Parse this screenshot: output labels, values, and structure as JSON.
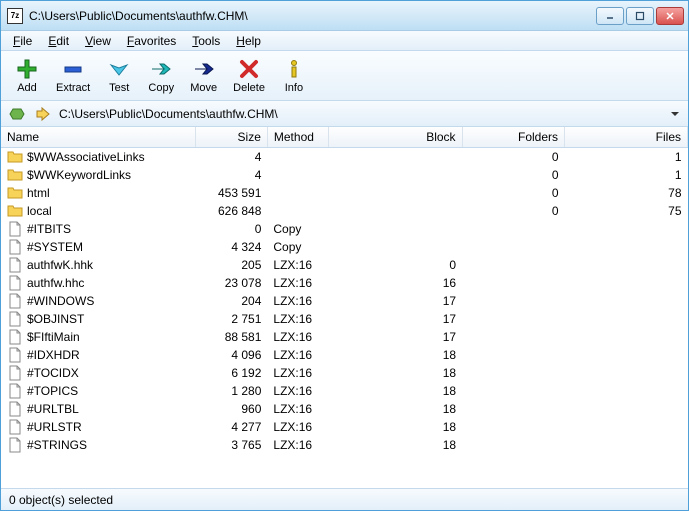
{
  "window": {
    "title": "C:\\Users\\Public\\Documents\\authfw.CHM\\"
  },
  "menus": [
    "File",
    "Edit",
    "View",
    "Favorites",
    "Tools",
    "Help"
  ],
  "toolbar": [
    {
      "id": "add",
      "label": "Add"
    },
    {
      "id": "extract",
      "label": "Extract"
    },
    {
      "id": "test",
      "label": "Test"
    },
    {
      "id": "copy",
      "label": "Copy"
    },
    {
      "id": "move",
      "label": "Move"
    },
    {
      "id": "delete",
      "label": "Delete"
    },
    {
      "id": "info",
      "label": "Info"
    }
  ],
  "address": {
    "path": "C:\\Users\\Public\\Documents\\authfw.CHM\\"
  },
  "columns": [
    "Name",
    "Size",
    "Method",
    "Block",
    "Folders",
    "Files"
  ],
  "rows": [
    {
      "type": "folder",
      "name": "$WWAssociativeLinks",
      "size": "4",
      "method": "",
      "block": "",
      "folders": "0",
      "files": "1"
    },
    {
      "type": "folder",
      "name": "$WWKeywordLinks",
      "size": "4",
      "method": "",
      "block": "",
      "folders": "0",
      "files": "1"
    },
    {
      "type": "folder",
      "name": "html",
      "size": "453 591",
      "method": "",
      "block": "",
      "folders": "0",
      "files": "78"
    },
    {
      "type": "folder",
      "name": "local",
      "size": "626 848",
      "method": "",
      "block": "",
      "folders": "0",
      "files": "75"
    },
    {
      "type": "file",
      "name": "#ITBITS",
      "size": "0",
      "method": "Copy",
      "block": "",
      "folders": "",
      "files": ""
    },
    {
      "type": "file",
      "name": "#SYSTEM",
      "size": "4 324",
      "method": "Copy",
      "block": "",
      "folders": "",
      "files": ""
    },
    {
      "type": "file",
      "name": "authfwK.hhk",
      "size": "205",
      "method": "LZX:16",
      "block": "0",
      "folders": "",
      "files": ""
    },
    {
      "type": "file",
      "name": "authfw.hhc",
      "size": "23 078",
      "method": "LZX:16",
      "block": "16",
      "folders": "",
      "files": ""
    },
    {
      "type": "file",
      "name": "#WINDOWS",
      "size": "204",
      "method": "LZX:16",
      "block": "17",
      "folders": "",
      "files": ""
    },
    {
      "type": "file",
      "name": "$OBJINST",
      "size": "2 751",
      "method": "LZX:16",
      "block": "17",
      "folders": "",
      "files": ""
    },
    {
      "type": "file",
      "name": "$FIftiMain",
      "size": "88 581",
      "method": "LZX:16",
      "block": "17",
      "folders": "",
      "files": ""
    },
    {
      "type": "file",
      "name": "#IDXHDR",
      "size": "4 096",
      "method": "LZX:16",
      "block": "18",
      "folders": "",
      "files": ""
    },
    {
      "type": "file",
      "name": "#TOCIDX",
      "size": "6 192",
      "method": "LZX:16",
      "block": "18",
      "folders": "",
      "files": ""
    },
    {
      "type": "file",
      "name": "#TOPICS",
      "size": "1 280",
      "method": "LZX:16",
      "block": "18",
      "folders": "",
      "files": ""
    },
    {
      "type": "file",
      "name": "#URLTBL",
      "size": "960",
      "method": "LZX:16",
      "block": "18",
      "folders": "",
      "files": ""
    },
    {
      "type": "file",
      "name": "#URLSTR",
      "size": "4 277",
      "method": "LZX:16",
      "block": "18",
      "folders": "",
      "files": ""
    },
    {
      "type": "file",
      "name": "#STRINGS",
      "size": "3 765",
      "method": "LZX:16",
      "block": "18",
      "folders": "",
      "files": ""
    }
  ],
  "status": "0 object(s) selected"
}
